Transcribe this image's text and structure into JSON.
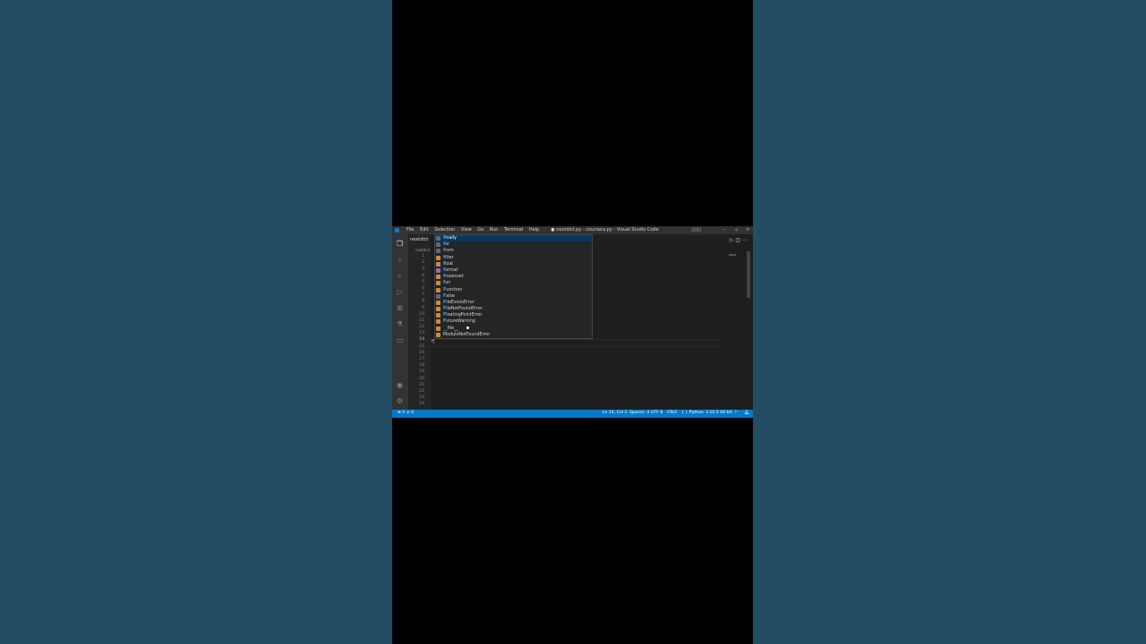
{
  "window": {
    "title": "● nextdict.py - coursera.py - Visual Studio Code"
  },
  "menu": [
    "File",
    "Edit",
    "Selection",
    "View",
    "Go",
    "Run",
    "Terminal",
    "Help"
  ],
  "tab": {
    "label": "nextdict"
  },
  "breadcrumb": "nextdict",
  "line_numbers": [
    "1",
    "2",
    "3",
    "4",
    "5",
    "6",
    "7",
    "8",
    "9",
    "10",
    "11",
    "12",
    "13",
    "14",
    "15",
    "16",
    "17",
    "18",
    "19",
    "20",
    "21",
    "22",
    "23",
    "24"
  ],
  "current_line": "14",
  "editor": {
    "typed_text": "f|"
  },
  "suggestions": [
    {
      "prefix": "f",
      "rest": "inally",
      "kind": "keyword"
    },
    {
      "prefix": "f",
      "rest": "or",
      "kind": "keyword"
    },
    {
      "prefix": "f",
      "rest": "rom",
      "kind": "keyword"
    },
    {
      "prefix": "f",
      "rest": "ilter",
      "kind": "class"
    },
    {
      "prefix": "f",
      "rest": "loat",
      "kind": "class"
    },
    {
      "prefix": "f",
      "rest": "ormat",
      "kind": "function"
    },
    {
      "prefix": "f",
      "rest": "rozenset",
      "kind": "class"
    },
    {
      "prefix": "f",
      "rest": "un",
      "kind": "class"
    },
    {
      "prefix": "F",
      "rest": "unction",
      "kind": "class"
    },
    {
      "prefix": "F",
      "rest": "alse",
      "kind": "keyword"
    },
    {
      "prefix": "F",
      "rest": "ileExistsError",
      "kind": "class"
    },
    {
      "prefix": "F",
      "rest": "ileNotFoundError",
      "kind": "class"
    },
    {
      "prefix": "F",
      "rest": "loatingPointError",
      "kind": "class"
    },
    {
      "prefix": "F",
      "rest": "utureWarning",
      "kind": "class"
    },
    {
      "prefix": "__",
      "rest": "file__",
      "kind": "class"
    },
    {
      "prefix": "",
      "rest": "ModuleNotFoundError",
      "kind": "class"
    }
  ],
  "status": {
    "problems": "⊗ 0 ⚠ 0",
    "position": "Ln 14, Col 2",
    "spaces": "Spaces: 4",
    "encoding": "UTF-8",
    "eol": "CRLF",
    "language": "{ } Python",
    "interpreter": "3.10.5 64-bit"
  },
  "colors": {
    "statusbar": "#007acc",
    "background": "#224d63",
    "editor": "#1e1e1e",
    "selected": "#04395e"
  },
  "icons": [
    "explorer-icon",
    "source-control-icon",
    "search-icon",
    "run-debug-icon",
    "extensions-icon",
    "testing-icon",
    "remote-icon",
    "account-icon",
    "settings-gear-icon"
  ]
}
